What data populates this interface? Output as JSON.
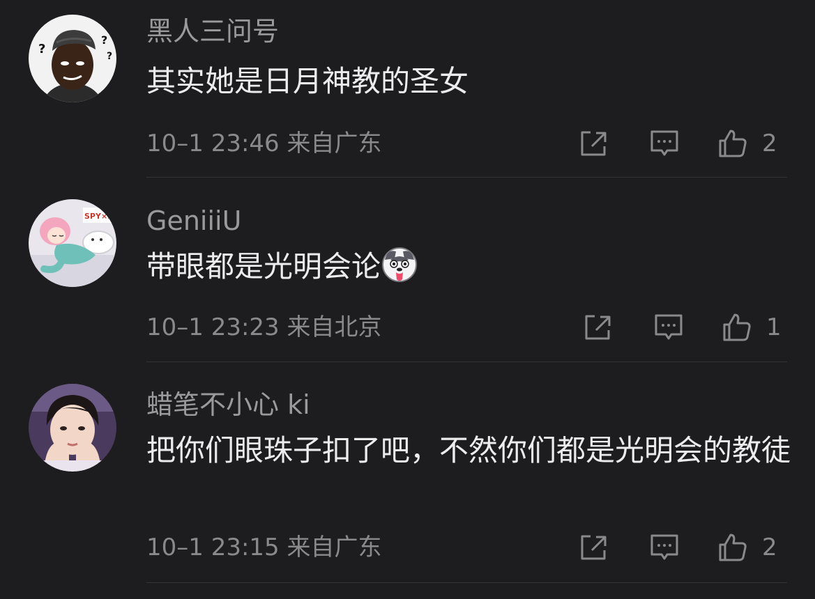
{
  "comments": [
    {
      "username": "黑人三问号",
      "text": "其实她是日月神教的圣女",
      "meta": "10–1 23:46 来自广东",
      "likes": "2",
      "avatar_icon": "confused-man-avatar"
    },
    {
      "username": "GeniiiU",
      "text": "带眼都是光明会论",
      "emoji_icon": "husky-tongue-out-emoji",
      "meta": "10–1 23:23 来自北京",
      "likes": "1",
      "avatar_icon": "anime-girl-sleeping-avatar",
      "avatar_text": "SPY×FAM"
    },
    {
      "username": "蜡笔不小心 ki",
      "text": "把你们眼珠子扣了吧，不然你们都是光明会的教徒",
      "meta": "10–1 23:15 来自广东",
      "likes": "2",
      "avatar_icon": "boy-hands-on-cheeks-avatar"
    }
  ],
  "colors": {
    "background": "#1d1d1f",
    "username": "#9a9a9c",
    "text": "#ececec",
    "meta": "#8a8a8c",
    "divider": "#343436"
  }
}
